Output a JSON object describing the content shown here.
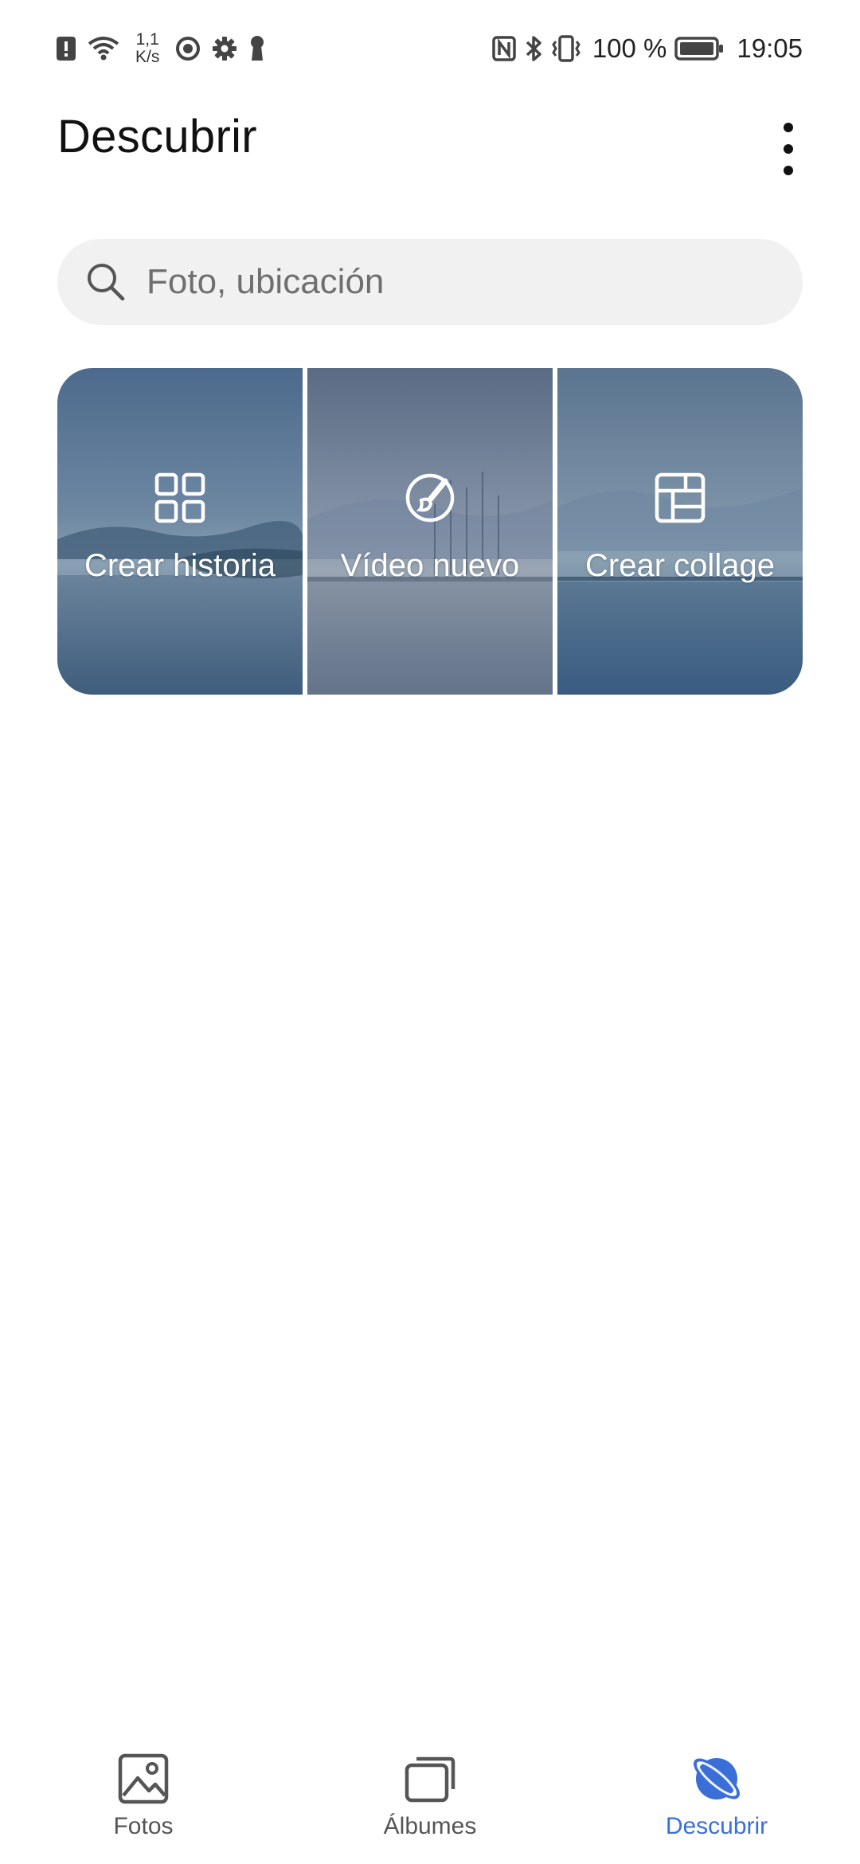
{
  "status_bar": {
    "speed_value": "1,1",
    "speed_unit": "K/s",
    "battery": "100 %",
    "time": "19:05",
    "icons_left": [
      "alert-icon",
      "wifi-icon",
      "media-icon",
      "settings-icon",
      "keyhole-icon"
    ],
    "icons_right": [
      "nfc-icon",
      "bluetooth-icon",
      "vibrate-icon",
      "battery-icon"
    ]
  },
  "header": {
    "title": "Descubrir",
    "menu_icon": "more-vert-icon"
  },
  "search": {
    "placeholder": "Foto, ubicación",
    "value": ""
  },
  "tiles": [
    {
      "label": "Crear historia",
      "icon": "grid-icon"
    },
    {
      "label": "Vídeo nuevo",
      "icon": "brush-icon"
    },
    {
      "label": "Crear collage",
      "icon": "collage-icon"
    }
  ],
  "bottom_nav": {
    "items": [
      {
        "label": "Fotos",
        "icon": "photo-icon",
        "active": false
      },
      {
        "label": "Álbumes",
        "icon": "albums-icon",
        "active": false
      },
      {
        "label": "Descubrir",
        "icon": "planet-icon",
        "active": true
      }
    ]
  },
  "colors": {
    "accent": "#3a6fd8",
    "search_bg": "#f1f1f1",
    "tile_tint": "#4a6a8c"
  }
}
